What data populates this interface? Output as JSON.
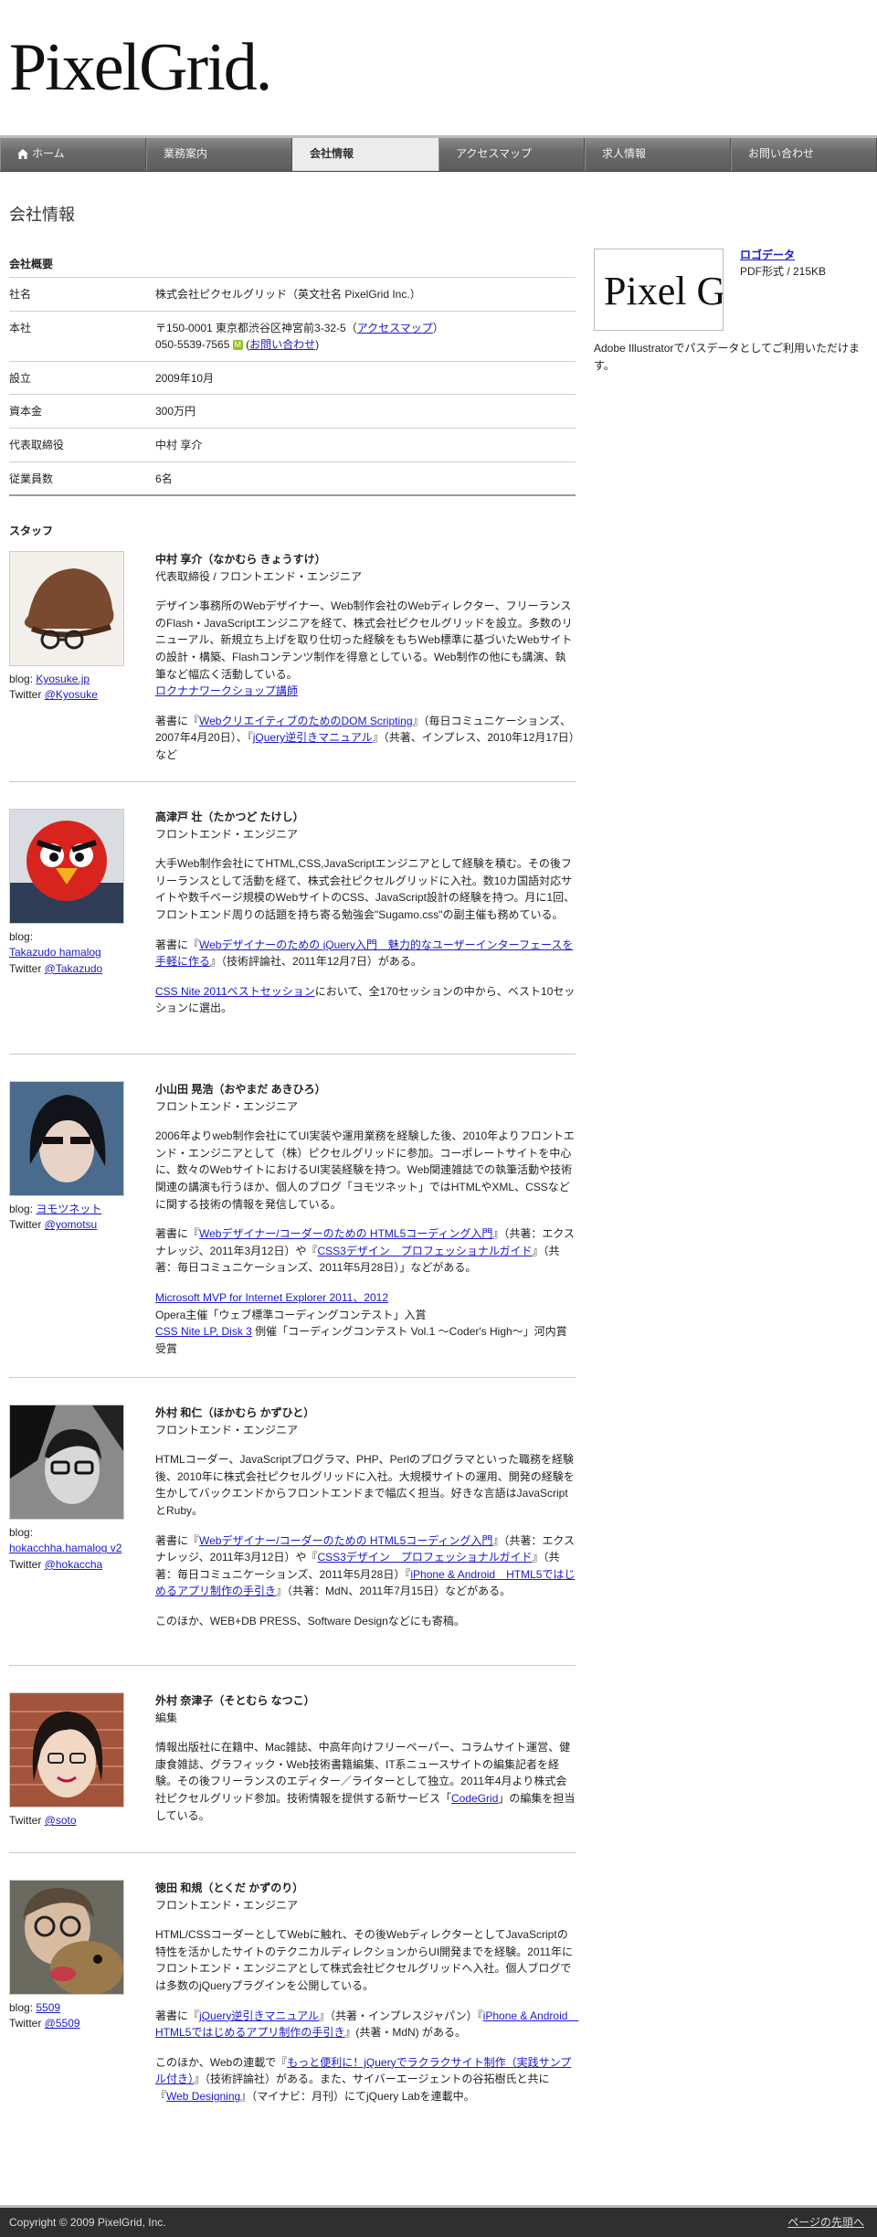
{
  "logo_text": "PixelGrid.",
  "nav": [
    {
      "label": "ホーム",
      "icon": "home-icon"
    },
    {
      "label": "業務案内"
    },
    {
      "label": "会社情報",
      "active": true
    },
    {
      "label": "アクセスマップ"
    },
    {
      "label": "求人情報"
    },
    {
      "label": "お問い合わせ"
    }
  ],
  "page_title": "会社情報",
  "company": {
    "heading": "会社概要",
    "name_label": "社名",
    "name_value": "株式会社ピクセルグリッド（英文社名 PixelGrid Inc.）",
    "address_label": "本社",
    "address_line1_prefix": "〒150-0001 東京都渋谷区神宮前3-32-5（",
    "address_access_link": "アクセスマップ",
    "address_line1_suffix": "）",
    "phone": "050-5539-7565",
    "mail_badge": "M",
    "contact_prefix": "(",
    "contact_link": "お問い合わせ",
    "contact_suffix": ")",
    "founded_label": "設立",
    "founded_value": "2009年10月",
    "capital_label": "資本金",
    "capital_value": "300万円",
    "ceo_label": "代表取締役",
    "ceo_value": "中村 享介",
    "employees_label": "従業員数",
    "employees_value": "6名"
  },
  "logo_data": {
    "thumb_text": "Pixel G",
    "link": "ロゴデータ",
    "format": "PDF形式 / 215KB",
    "desc": "Adobe Illustratorでパスデータとしてご利用いただけます。"
  },
  "staff_heading": "スタッフ",
  "staff": [
    {
      "name": "中村 享介（なかむら きょうすけ）",
      "role": "代表取締役 / フロントエンド・エンジニア",
      "blog_label": "blog: ",
      "blog_link": "Kyosuke.jp",
      "twitter_label": "Twitter ",
      "twitter_link": "@Kyosuke",
      "p1": "デザイン事務所のWebデザイナー、Web制作会社のWebディレクター、フリーランスのFlash・JavaScriptエンジニアを経て、株式会社ピクセルグリッドを設立。多数のリニューアル、新規立ち上げを取り仕切った経験をもちWeb標準に基づいたWebサイトの設計・構築、Flashコンテンツ制作を得意としている。Web制作の他にも講演、執筆など幅広く活動している。",
      "p1_link": "ロクナナワークショップ講師",
      "p2_a": "著書に『",
      "p2_link1": "WebクリエイティブのためのDOM Scripting",
      "p2_b": "』（毎日コミュニケーションズ、2007年4月20日）、『",
      "p2_link2": "jQuery逆引きマニュアル",
      "p2_c": "』（共著、インプレス、2010年12月17日）など"
    },
    {
      "name": "高津戸 壮（たかつど たけし）",
      "role": "フロントエンド・エンジニア",
      "blog_label": "blog: ",
      "blog_link": "Takazudo hamalog",
      "twitter_label": "Twitter ",
      "twitter_link": "@Takazudo",
      "p1": "大手Web制作会社にてHTML,CSS,JavaScriptエンジニアとして経験を積む。その後フリーランスとして活動を経て、株式会社ピクセルグリッドに入社。数10カ国語対応サイトや数千ページ規模のWebサイトのCSS、JavaScript設計の経験を持つ。月に1回、フロントエンド周りの話題を持ち寄る勉強会\"Sugamo.css\"の副主催も務めている。",
      "p2_a": "著書に『",
      "p2_link1": "Webデザイナーのための jQuery入門　魅力的なユーザーインターフェースを手軽に作る",
      "p2_b": "』（技術評論社、2011年12月7日）がある。",
      "p3_link": "CSS Nite 2011ベストセッション",
      "p3_b": "において、全170セッションの中から、ベスト10セッションに選出。"
    },
    {
      "name": "小山田 晃浩（おやまだ あきひろ）",
      "role": "フロントエンド・エンジニア",
      "blog_label": "blog: ",
      "blog_link": "ヨモツネット",
      "twitter_label": "Twitter ",
      "twitter_link": "@yomotsu",
      "p1": "2006年よりweb制作会社にてUI実装や運用業務を経験した後、2010年よりフロントエンド・エンジニアとして（株）ピクセルグリッドに参加。コーポレートサイトを中心に、数々のWebサイトにおけるUI実装経験を持つ。Web関連雑誌での執筆活動や技術関連の講演も行うほか、個人のブログ「ヨモツネット」ではHTMLやXML、CSSなどに関する技術の情報を発信している。",
      "p2_a": "著書に『",
      "p2_link1": "Webデザイナー/コーダーのための HTML5コーディング入門",
      "p2_b": "』（共著：エクスナレッジ、2011年3月12日）や『",
      "p2_link2": "CSS3デザイン　プロフェッショナルガイド",
      "p2_c": "』（共著：毎日コミュニケーションズ、2011年5月28日）」などがある。",
      "a1_link": "Microsoft MVP for Internet Explorer 2011、2012",
      "a2": "Opera主催「ウェブ標準コーディングコンテスト」入賞",
      "a3_link": "CSS Nite LP, Disk 3",
      "a3_b": " 例催「コーディングコンテスト Vol.1 〜Coder's High〜」河内賞受賞"
    },
    {
      "name": "外村 和仁（ほかむら かずひと）",
      "role": "フロントエンド・エンジニア",
      "blog_label": "blog: ",
      "blog_link": "hokacchha.hamalog v2",
      "twitter_label": "Twitter ",
      "twitter_link": "@hokaccha",
      "p1": "HTMLコーダー、JavaScriptプログラマ、PHP、Perlのプログラマといった職務を経験後、2010年に株式会社ピクセルグリッドに入社。大規模サイトの運用、開発の経験を生かしてバックエンドからフロントエンドまで幅広く担当。好きな言語はJavaScriptとRuby。",
      "p2_a": "著書に『",
      "p2_link1": "Webデザイナー/コーダーのための HTML5コーディング入門",
      "p2_b": "』（共著：エクスナレッジ、2011年3月12日）や『",
      "p2_link2": "CSS3デザイン　プロフェッショナルガイド",
      "p2_c": "』（共著：毎日コミュニケーションズ、2011年5月28日）『",
      "p2_link3": "iPhone & Android　HTML5ではじめるアプリ制作の手引き",
      "p2_d": "』（共著：MdN、2011年7月15日）などがある。",
      "p3": "このほか、WEB+DB PRESS、Software Designなどにも寄稿。"
    },
    {
      "name": "外村 奈津子（そとむら なつこ）",
      "role": "編集",
      "twitter_label": "Twitter ",
      "twitter_link": "@soto",
      "p1_a": "情報出版社に在籍中、Mac雑誌、中高年向けフリーペーパー、コラムサイト運営、健康食雑誌、グラフィック・Web技術書籍編集、IT系ニュースサイトの編集記者を経験。その後フリーランスのエディター／ライターとして独立。2011年4月より株式会社ピクセルグリッド参加。技術情報を提供する新サービス「",
      "p1_link": "CodeGrid",
      "p1_b": "」の編集を担当している。"
    },
    {
      "name": "徳田 和規（とくだ かずのり）",
      "role": "フロントエンド・エンジニア",
      "blog_label": "blog: ",
      "blog_link": "5509",
      "twitter_label": "Twitter ",
      "twitter_link": "@5509",
      "p1": "HTML/CSSコーダーとしてWebに触れ、その後WebディレクターとしてJavaScriptの特性を活かしたサイトのテクニカルディレクションからUI開発までを経験。2011年にフロントエンド・エンジニアとして株式会社ピクセルグリッドへ入社。個人ブログでは多数のjQueryプラグインを公開している。",
      "p2_a": "著書に『",
      "p2_link1": "jQuery逆引きマニュアル",
      "p2_b": "』（共著・インプレスジャパン）『",
      "p2_link2": "iPhone & Android　HTML5ではじめるアプリ制作の手引き",
      "p2_c": "』(共著・MdN) がある。",
      "p3_a": "このほか、Webの連載で『",
      "p3_link1": "もっと便利に！jQueryでラクラクサイト制作（実践サンプル付き）",
      "p3_b": "』（技術評論社）がある。また、サイバーエージェントの谷拓樹氏と共に『",
      "p3_link2": "Web Designing",
      "p3_c": "』（マイナビ：月刊）にてjQuery Labを連載中。"
    }
  ],
  "footer": {
    "copyright": "Copyright © 2009 PixelGrid, Inc.",
    "page_top": "ページの先頭へ"
  }
}
